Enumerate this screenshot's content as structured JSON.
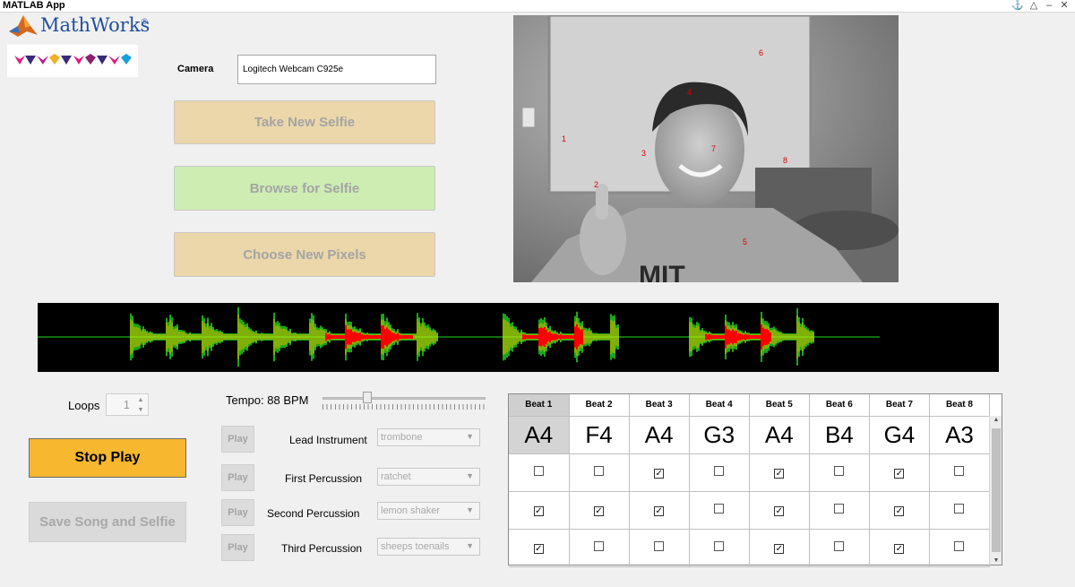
{
  "window": {
    "title": "MATLAB App",
    "controls": [
      "pin-icon",
      "collapse-icon",
      "minimize-icon",
      "close-icon"
    ]
  },
  "logo": {
    "text": "MathWorks",
    "registered": "®"
  },
  "camera": {
    "label": "Camera",
    "value": "Logitech Webcam C925e"
  },
  "buttons": {
    "take_selfie": "Take New Selfie",
    "browse_selfie": "Browse for Selfie",
    "choose_pixels": "Choose New Pixels",
    "stop_play": "Stop Play",
    "save_song": "Save Song and Selfie"
  },
  "photo": {
    "pixel_markers": [
      "1",
      "2",
      "3",
      "4",
      "5",
      "6",
      "7",
      "8"
    ]
  },
  "loops": {
    "label": "Loops",
    "value": "1"
  },
  "tempo": {
    "label": "Tempo: 88 BPM",
    "bpm": 88,
    "position_fraction": 0.26
  },
  "instruments": [
    {
      "play": "Play",
      "label": "Lead Instrument",
      "selected": "trombone"
    },
    {
      "play": "Play",
      "label": "First Percussion",
      "selected": "ratchet"
    },
    {
      "play": "Play",
      "label": "Second Percussion",
      "selected": "lemon shaker"
    },
    {
      "play": "Play",
      "label": "Third Percussion",
      "selected": "sheeps toenails"
    }
  ],
  "beats": {
    "headers": [
      "Beat 1",
      "Beat 2",
      "Beat 3",
      "Beat 4",
      "Beat 5",
      "Beat 6",
      "Beat 7",
      "Beat 8"
    ],
    "notes": [
      "A4",
      "F4",
      "A4",
      "G3",
      "A4",
      "B4",
      "G4",
      "A3"
    ],
    "selected_beat_index": 0,
    "percussion": [
      [
        false,
        false,
        true,
        false,
        true,
        false,
        true,
        false
      ],
      [
        true,
        true,
        true,
        false,
        true,
        false,
        true,
        false
      ],
      [
        true,
        false,
        false,
        false,
        true,
        false,
        true,
        false
      ]
    ]
  },
  "colors": {
    "take_selfie_bg": "#ebd7a9",
    "browse_selfie_bg": "#cdedb3",
    "choose_pixels_bg": "#ebd7a9",
    "stop_play_bg": "#f7b82f",
    "wave_green": "#22dd22",
    "wave_yellow": "#f0f000",
    "wave_red": "#ff0000"
  }
}
